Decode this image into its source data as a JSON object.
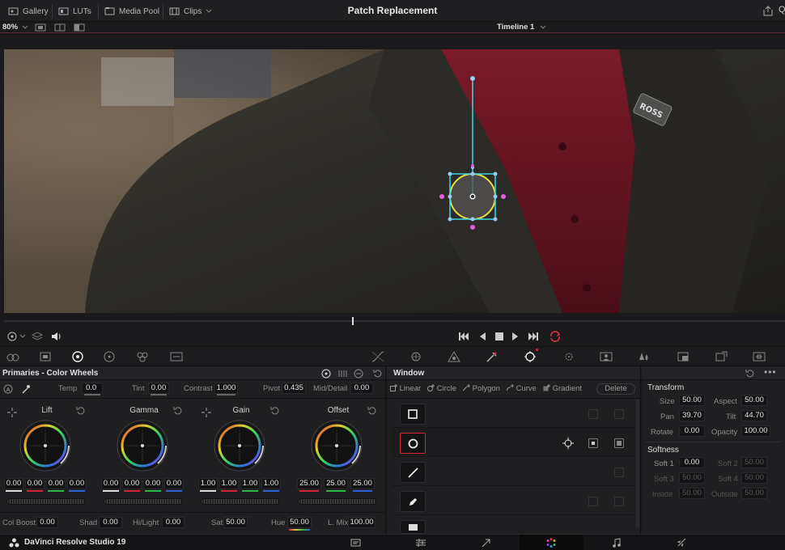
{
  "topbar": {
    "gallery": "Gallery",
    "luts": "LUTs",
    "media_pool": "Media Pool",
    "clips": "Clips",
    "title": "Patch Replacement"
  },
  "viewerbar": {
    "zoom": "80%",
    "timeline": "Timeline 1"
  },
  "primaries": {
    "title": "Primaries - Color Wheels",
    "temp_label": "Temp",
    "temp": "0.0",
    "tint_label": "Tint",
    "tint": "0.00",
    "contrast_label": "Contrast",
    "contrast": "1.000",
    "pivot_label": "Pivot",
    "pivot": "0.435",
    "middetail_label": "Mid/Detail",
    "middetail": "0.00",
    "wheels": [
      {
        "name": "Lift",
        "values": [
          "0.00",
          "0.00",
          "0.00",
          "0.00"
        ]
      },
      {
        "name": "Gamma",
        "values": [
          "0.00",
          "0.00",
          "0.00",
          "0.00"
        ]
      },
      {
        "name": "Gain",
        "values": [
          "1.00",
          "1.00",
          "1.00",
          "1.00"
        ]
      },
      {
        "name": "Offset",
        "values": [
          "25.00",
          "25.00",
          "25.00"
        ]
      }
    ],
    "colboost_label": "Col Boost",
    "colboost": "0.00",
    "shad_label": "Shad",
    "shad": "0.00",
    "hilight_label": "Hi/Light",
    "hilight": "0.00",
    "sat_label": "Sat",
    "sat": "50.00",
    "hue_label": "Hue",
    "hue": "50.00",
    "lmix_label": "L. Mix",
    "lmix": "100.00"
  },
  "window": {
    "title": "Window",
    "tools": [
      "Linear",
      "Circle",
      "Polygon",
      "Curve",
      "Gradient"
    ],
    "delete": "Delete"
  },
  "transform": {
    "title": "Transform",
    "size_label": "Size",
    "size": "50.00",
    "aspect_label": "Aspect",
    "aspect": "50.00",
    "pan_label": "Pan",
    "pan": "39.70",
    "tilt_label": "Tilt",
    "tilt": "44.70",
    "rotate_label": "Rotate",
    "rotate": "0.00",
    "opacity_label": "Opacity",
    "opacity": "100.00",
    "softness_title": "Softness",
    "soft1_label": "Soft 1",
    "soft1": "0.00",
    "soft2_label": "Soft 2",
    "soft2": "50.00",
    "soft3_label": "Soft 3",
    "soft3": "50.00",
    "soft4_label": "Soft 4",
    "soft4": "50.00",
    "inside_label": "Inside",
    "inside": "50.00",
    "outside_label": "Outside",
    "outside": "50.00"
  },
  "bottombar": {
    "app_name": "DaVinci Resolve Studio 19"
  },
  "colors": {
    "accent_red": "#d8243a",
    "tracker_cyan": "#35d8e8",
    "tracker_yellow": "#f0e040",
    "tracker_magenta": "#e060e0"
  }
}
